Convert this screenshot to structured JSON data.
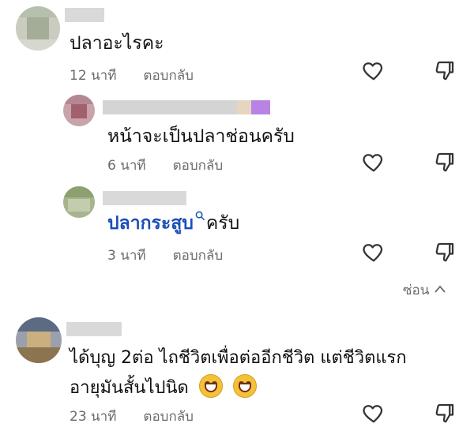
{
  "comments": [
    {
      "text": "ปลาอะไรคะ",
      "time": "12 นาที",
      "reply_label": "ตอบกลับ"
    },
    {
      "text": "หน้าจะเป็นปลาช่อนครับ",
      "time": "6 นาที",
      "reply_label": "ตอบกลับ"
    },
    {
      "tag": "ปลากระสูบ",
      "text_after": "ครับ",
      "time": "3 นาที",
      "reply_label": "ตอบกลับ"
    },
    {
      "line1": "ได้บุญ 2ต่อ ไถชีวิตเพื่อต่ออีกชีวิต แต่ชีวิตแรก",
      "line2": "อายุมันสั้นไปนิด",
      "time": "23 นาที",
      "reply_label": "ตอบกลับ"
    }
  ],
  "hide_replies": {
    "label": "ซ่อน"
  },
  "icons": {
    "like": "heart-outline-icon",
    "dislike": "thumbs-down-outline-icon",
    "search": "search-icon",
    "emoji": "grinning-face-emoji",
    "chevron": "chevron-up-icon"
  },
  "colors": {
    "tag": "#1a4fb8",
    "meta": "#6b6b6b"
  }
}
